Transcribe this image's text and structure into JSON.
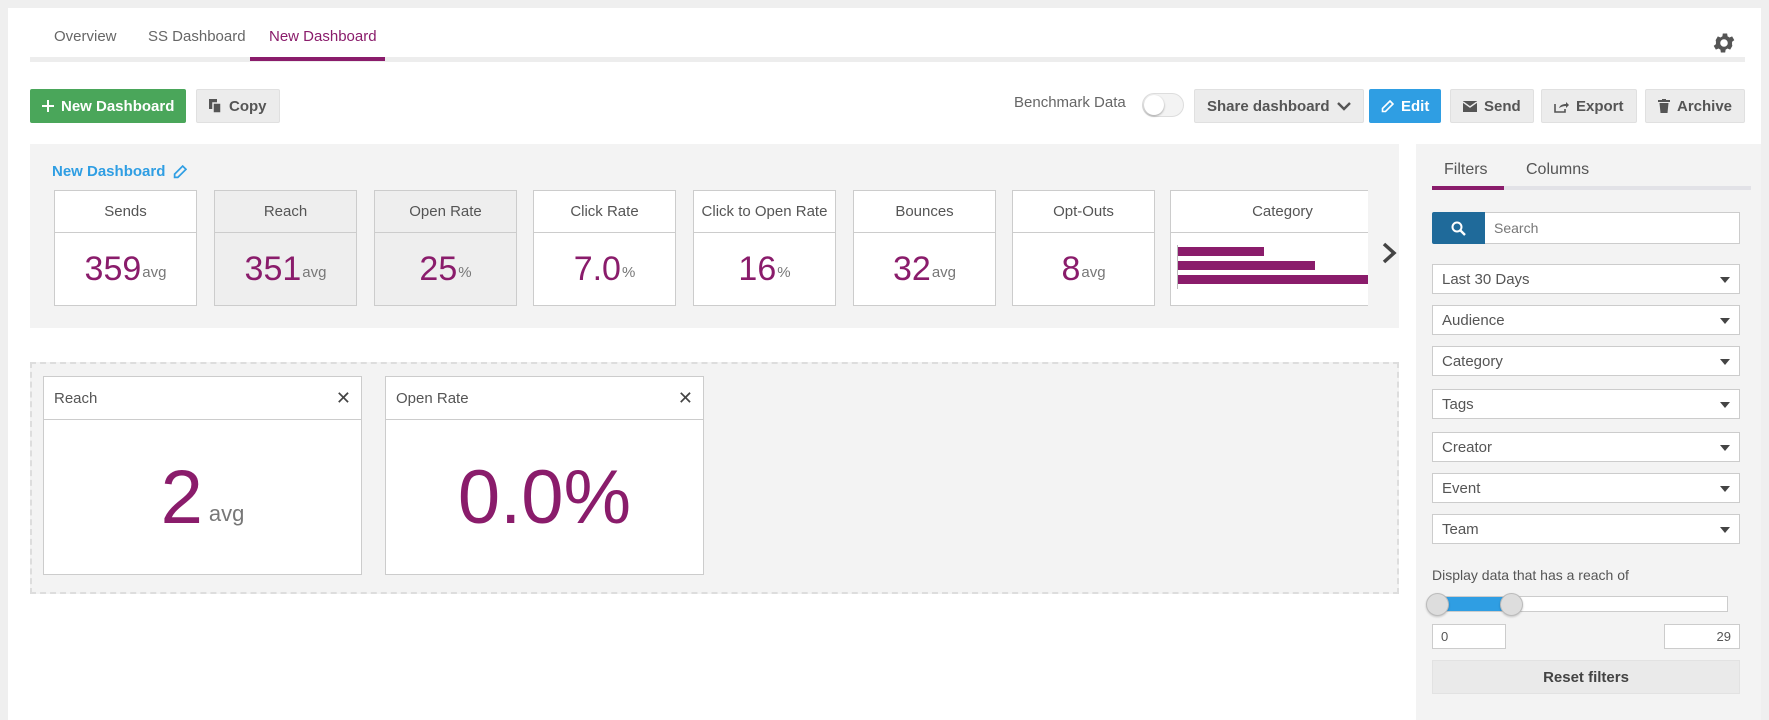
{
  "tabs": [
    {
      "label": "Overview"
    },
    {
      "label": "SS Dashboard"
    },
    {
      "label": "New Dashboard",
      "active": true
    }
  ],
  "toolbar": {
    "new_dashboard": "New Dashboard",
    "copy": "Copy",
    "benchmark_label": "Benchmark Data",
    "benchmark_on": false,
    "share": "Share dashboard",
    "edit": "Edit",
    "send": "Send",
    "export": "Export",
    "archive": "Archive"
  },
  "dashboard": {
    "title": "New Dashboard",
    "stats": [
      {
        "label": "Sends",
        "value": "359",
        "unit": "avg",
        "selected": false
      },
      {
        "label": "Reach",
        "value": "351",
        "unit": "avg",
        "selected": true
      },
      {
        "label": "Open Rate",
        "value": "25",
        "unit": "%",
        "selected": true
      },
      {
        "label": "Click Rate",
        "value": "7.0",
        "unit": "%",
        "selected": false
      },
      {
        "label": "Click to Open Rate",
        "value": "16",
        "unit": "%",
        "selected": false
      },
      {
        "label": "Bounces",
        "value": "32",
        "unit": "avg",
        "selected": false
      },
      {
        "label": "Opt-Outs",
        "value": "8",
        "unit": "avg",
        "selected": false
      }
    ],
    "category_card": {
      "label": "Category",
      "bar_fractions": [
        0.45,
        0.72,
        1.0
      ]
    }
  },
  "widgets": [
    {
      "title": "Reach",
      "value": "2",
      "unit": "avg"
    },
    {
      "title": "Open Rate",
      "value": "0.0%",
      "unit": ""
    }
  ],
  "sidebar": {
    "tabs": [
      {
        "label": "Filters",
        "active": true
      },
      {
        "label": "Columns",
        "active": false
      }
    ],
    "search_placeholder": "Search",
    "filters": [
      "Last 30 Days",
      "Audience",
      "Category",
      "Tags",
      "Creator",
      "Event",
      "Team"
    ],
    "reach_label": "Display data that has a reach of",
    "reach_min": "0",
    "reach_max": "29",
    "reach_range_fraction": [
      0.0,
      0.25
    ],
    "reset": "Reset filters"
  },
  "colors": {
    "accent": "#8a1c6b",
    "primary_blue": "#2f9ee3",
    "search_blue": "#1f6a9a",
    "green": "#4aa65a"
  }
}
